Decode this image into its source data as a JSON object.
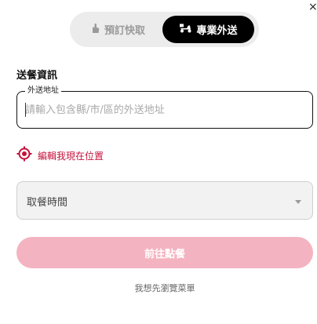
{
  "dialog": {
    "close_symbol": "×"
  },
  "mode_toggle": {
    "pickup_label": "預訂快取",
    "pickup_icon": "hand-icon",
    "delivery_label": "專業外送",
    "delivery_icon": "scooter-icon",
    "selected": "delivery"
  },
  "section_title": "送餐資訊",
  "address": {
    "label": "外送地址",
    "value": "",
    "placeholder": "請輸入包含縣/市/區的外送地址"
  },
  "locate": {
    "label": "編輯我現在位置",
    "icon": "location-target-icon"
  },
  "pickup_time": {
    "value": "取餐時間"
  },
  "submit_label": "前往點餐",
  "browse_label": "我想先瀏覽菜單",
  "colors": {
    "accent": "#c4123b",
    "button_disabled": "#f4b3c0",
    "toggle_active": "#000000",
    "toggle_bg": "#ececec"
  }
}
